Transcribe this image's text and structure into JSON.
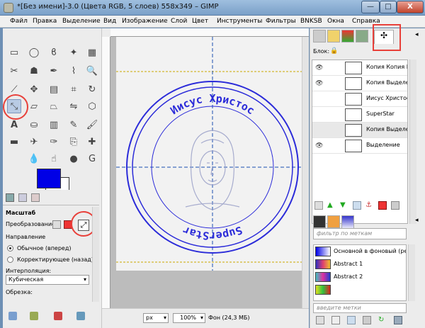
{
  "window": {
    "title": "*[Без имени]-3.0 (Цвета RGB, 5 слоев) 558x349 – GIMP",
    "minimize": "—",
    "maximize": "□",
    "close": "X"
  },
  "menu": [
    "Файл",
    "Правка",
    "Выделение",
    "Вид",
    "Изображение",
    "Слой",
    "Цвет",
    "Инструменты",
    "Фильтры",
    "BNKSB",
    "Окна",
    "Справка"
  ],
  "tool_options": {
    "title": "Масштаб",
    "transform_label": "Преобразование:",
    "direction_label": "Направление",
    "direction_normal": "Обычное (вперед)",
    "direction_corrective": "Корректирующее (назад)",
    "interpolation_label": "Интерполяция:",
    "interpolation_value": "Кубическая",
    "clipping_label": "Обрезка:"
  },
  "canvas": {
    "top_text": "Иисус Христос",
    "bottom_text": "SuperStar"
  },
  "statusbar": {
    "unit": "px",
    "zoom": "100%",
    "info": "Фон (24,3 МБ)"
  },
  "layers_panel": {
    "lock_label": "Блок:",
    "layers": [
      {
        "name": "Копия Копия Выделе",
        "visible": true
      },
      {
        "name": "Копия Выделение",
        "visible": true
      },
      {
        "name": "Иисус Христос",
        "visible": false
      },
      {
        "name": "SuperStar",
        "visible": false
      },
      {
        "name": "Копия Выделение #",
        "visible": false
      },
      {
        "name": "Выделение",
        "visible": true
      }
    ]
  },
  "gradients_panel": {
    "filter_placeholder": "фильтр по меткам",
    "tag_placeholder": "введите метки",
    "items": [
      {
        "name": "Основной в фоновый (резк",
        "colors": [
          "#0000e6",
          "#ffffff"
        ]
      },
      {
        "name": "Abstract 1",
        "colors": [
          "#3030c0",
          "#e04070",
          "#f0c030"
        ]
      },
      {
        "name": "Abstract 2",
        "colors": [
          "#40c0c0",
          "#e030a0",
          "#2040d0"
        ]
      },
      {
        "name": "Abstract 3",
        "colors": [
          "#e0e020",
          "#30c040",
          "#e02020"
        ]
      }
    ]
  },
  "colors": {
    "foreground": "#0000e6",
    "background": "#ffffff",
    "stamp_ink": "#2b2bd9",
    "highlight_circle": "#e8403a"
  }
}
